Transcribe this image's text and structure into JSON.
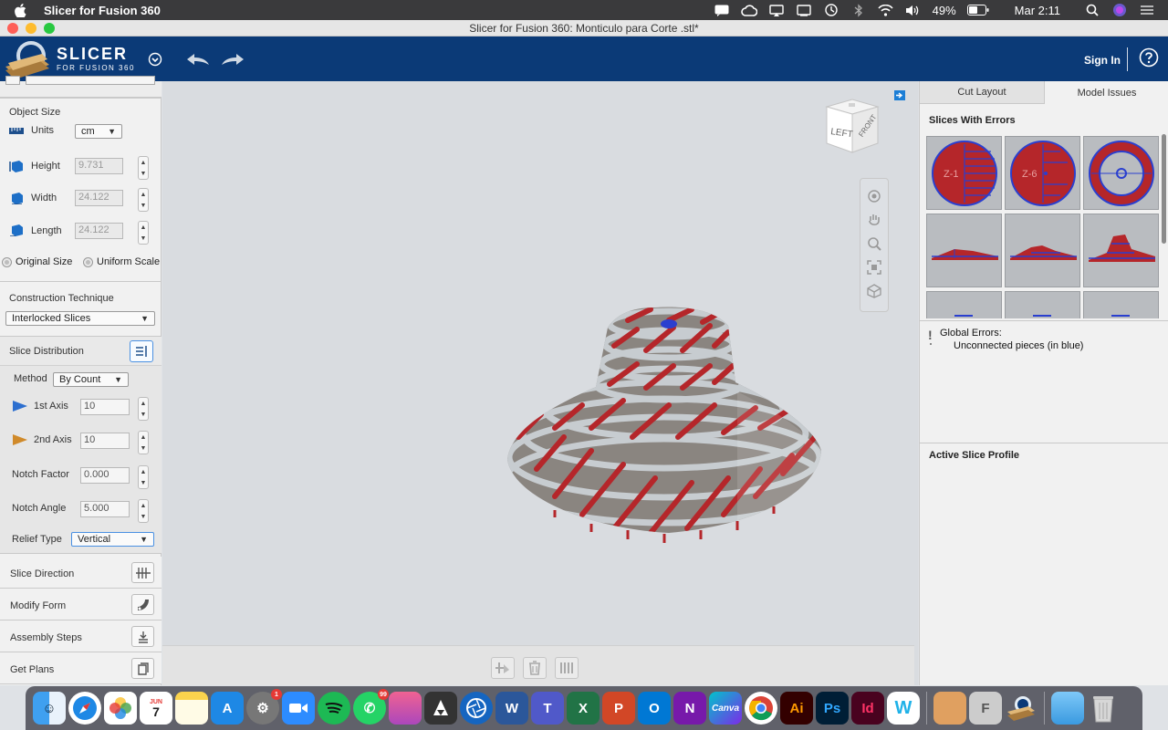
{
  "menubar": {
    "app_name": "Slicer for Fusion 360",
    "battery": "49%",
    "time": "Mar 2:11"
  },
  "window": {
    "title": "Slicer for Fusion 360: Monticulo para Corte .stl*"
  },
  "header": {
    "logo_title": "SLICER",
    "logo_subtitle": "FOR FUSION 360",
    "sign_in": "Sign In"
  },
  "object_size": {
    "title": "Object Size",
    "units_label": "Units",
    "units_value": "cm",
    "height_label": "Height",
    "height_value": "9.731",
    "width_label": "Width",
    "width_value": "24.122",
    "length_label": "Length",
    "length_value": "24.122",
    "original_size": "Original Size",
    "uniform_scale": "Uniform Scale"
  },
  "construction": {
    "title": "Construction Technique",
    "value": "Interlocked Slices"
  },
  "slice_distribution": {
    "title": "Slice Distribution",
    "method_label": "Method",
    "method_value": "By Count",
    "axis1_label": "1st Axis",
    "axis1_value": "10",
    "axis2_label": "2nd Axis",
    "axis2_value": "10",
    "notch_factor_label": "Notch Factor",
    "notch_factor_value": "0.000",
    "notch_angle_label": "Notch Angle",
    "notch_angle_value": "5.000",
    "relief_type_label": "Relief Type",
    "relief_type_value": "Vertical"
  },
  "bottom_buttons": {
    "slice_direction": "Slice Direction",
    "modify_form": "Modify Form",
    "assembly_steps": "Assembly Steps",
    "get_plans": "Get Plans"
  },
  "viewcube": {
    "left": "LEFT",
    "front": "FRONT"
  },
  "right_panel": {
    "tab_cut_layout": "Cut Layout",
    "tab_model_issues": "Model Issues",
    "slices_with_errors": "Slices With Errors",
    "thumb_label_1": "Z-1",
    "thumb_label_2": "Z-6",
    "global_errors_title": "Global Errors:",
    "global_errors_item": "Unconnected pieces (in blue)",
    "active_slice_profile": "Active Slice Profile"
  },
  "dock": {
    "calendar_month": "JUN",
    "calendar_day": "7",
    "settings_badge": "1",
    "whatsapp_badge": "99",
    "canva": "Canva",
    "illustrator": "Ai",
    "photoshop": "Ps",
    "indesign": "Id"
  },
  "colors": {
    "header_blue": "#0b3a77",
    "slice_red": "#b5262a",
    "error_blue": "#2a3fcf"
  }
}
